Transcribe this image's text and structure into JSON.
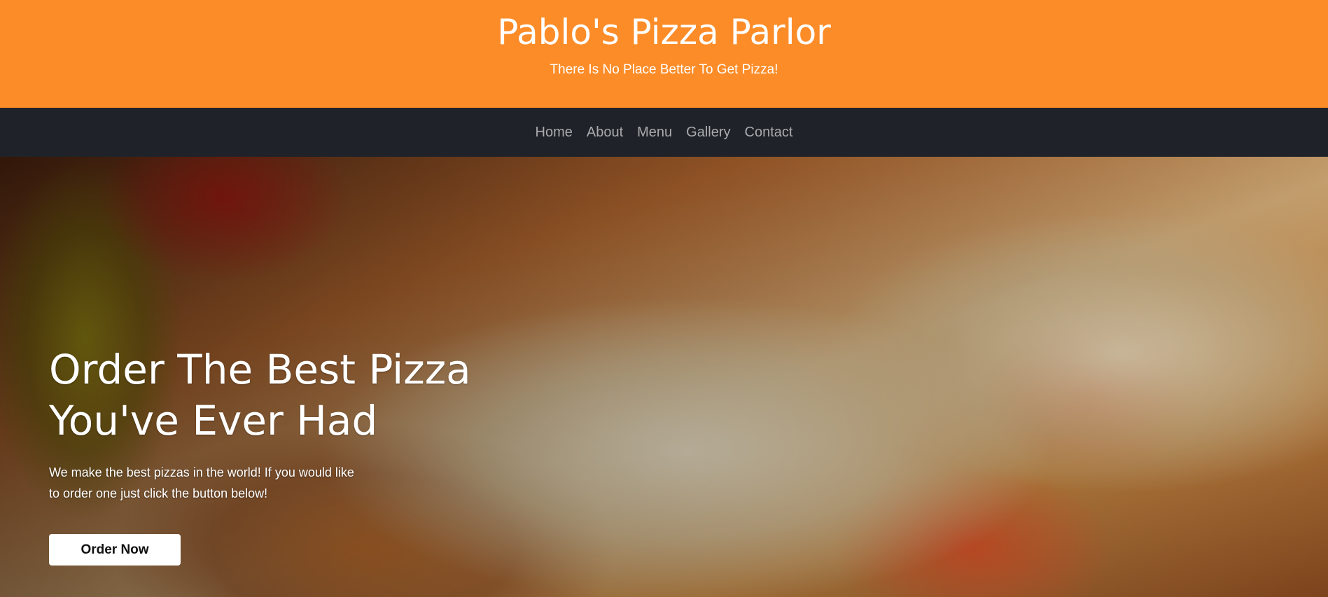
{
  "header": {
    "title": "Pablo's Pizza Parlor",
    "tagline": "There Is No Place Better To Get Pizza!"
  },
  "nav": {
    "items": [
      {
        "label": "Home"
      },
      {
        "label": "About"
      },
      {
        "label": "Menu"
      },
      {
        "label": "Gallery"
      },
      {
        "label": "Contact"
      }
    ]
  },
  "hero": {
    "heading_line1": "Order The Best Pizza",
    "heading_line2": "You've Ever Had",
    "text_line1": "We make the best pizzas in the world! If you would like",
    "text_line2": "to order one just click the button below!",
    "button_label": "Order Now"
  },
  "colors": {
    "header_background": "#fc8c28",
    "navbar_background": "#1f2329",
    "nav_link": "#a8aaad",
    "button_background": "#ffffff"
  }
}
